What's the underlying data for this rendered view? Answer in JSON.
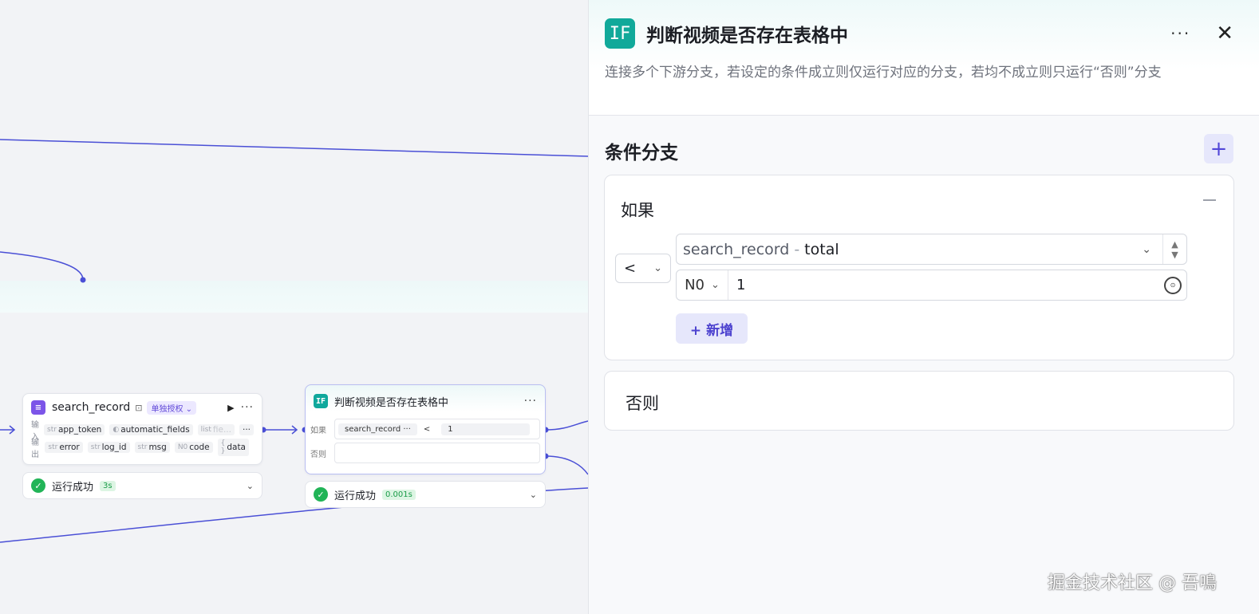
{
  "canvas": {
    "search_node": {
      "title": "search_record",
      "auth_badge": "单独授权",
      "input_label": "输入",
      "output_label": "输出",
      "inputs": [
        {
          "type": "str",
          "name": "app_token"
        },
        {
          "type": "",
          "name": "automatic_fields"
        },
        {
          "type": "list",
          "name": "fie..."
        }
      ],
      "outputs": [
        {
          "type": "str",
          "name": "error"
        },
        {
          "type": "str",
          "name": "log_id"
        },
        {
          "type": "str",
          "name": "msg"
        },
        {
          "type": "N0",
          "name": "code"
        },
        {
          "type": "{ }",
          "name": "data"
        }
      ],
      "status": "运行成功",
      "duration": "3s"
    },
    "if_node": {
      "title": "判断视频是否存在表格中",
      "if_label": "如果",
      "else_label": "否则",
      "cond_left": "search_record ···",
      "cond_op": "<",
      "cond_value": "1",
      "status": "运行成功",
      "duration": "0.001s"
    }
  },
  "panel": {
    "icon_text": "IF",
    "title": "判断视频是否存在表格中",
    "description": "连接多个下游分支，若设定的条件成立则仅运行对应的分支，若均不成立则只运行“否则”分支",
    "section_title": "条件分支",
    "if_label": "如果",
    "else_label": "否则",
    "operator": "<",
    "left_var": "search_record",
    "left_sep": "-",
    "left_prop": "total",
    "right_type": "N0",
    "right_value": "1",
    "add_condition": "+ 新增"
  },
  "watermark": "掘金技术社区 @ 吾鳴",
  "colors": {
    "accent": "#5247d8",
    "teal": "#11a99a",
    "success": "#21b457",
    "edge": "#4a4fd6"
  }
}
